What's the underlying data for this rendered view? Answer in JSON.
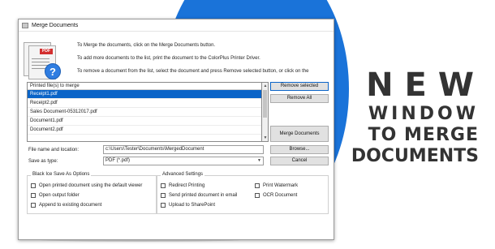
{
  "window": {
    "title": "Merge Documents"
  },
  "instructions": [
    "To Merge the documents, click on the Merge Documents button.",
    "To add more documents to the list, print the document to the ColorPlus Printer Driver.",
    "To remove a document from the list, select the document and press Remove selected button, or click on the"
  ],
  "icon_labels": {
    "pdf": "PDF"
  },
  "list": {
    "header": "Printed file(s) to merge",
    "items": [
      {
        "label": "Receipt1.pdf",
        "selected": true
      },
      {
        "label": "Receipt2.pdf",
        "selected": false
      },
      {
        "label": "Sales Document-05312017.pdf",
        "selected": false
      },
      {
        "label": "Document1.pdf",
        "selected": false
      },
      {
        "label": "Document2.pdf",
        "selected": false
      }
    ]
  },
  "buttons": {
    "remove_selected": "Remove selected",
    "remove_all": "Remove All",
    "merge_documents": "Merge Documents",
    "browse": "Browse...",
    "cancel": "Cancel"
  },
  "fields": {
    "file_name_label": "File name and location:",
    "file_name_value": "c:\\Users\\Tester\\Documents\\MergedDocument",
    "save_as_label": "Save as type:",
    "save_as_value": "PDF (*.pdf)"
  },
  "options_group": {
    "title": "Black Ice Save As Options",
    "items": [
      "Open printed document using the default viewer",
      "Open output folder",
      "Append to existing document"
    ]
  },
  "advanced_group": {
    "title": "Advanced Settings",
    "items": [
      "Redirect Printing",
      "Send printed document in email",
      "Upload to SharePoint",
      "Print Watermark",
      "OCR Document"
    ]
  },
  "headline": [
    "NEW",
    "WINDOW",
    "TO MERGE",
    "DOCUMENTS"
  ],
  "colors": {
    "accent": "#1a73d9",
    "selection": "#0a64c8",
    "headline": "#333333"
  }
}
